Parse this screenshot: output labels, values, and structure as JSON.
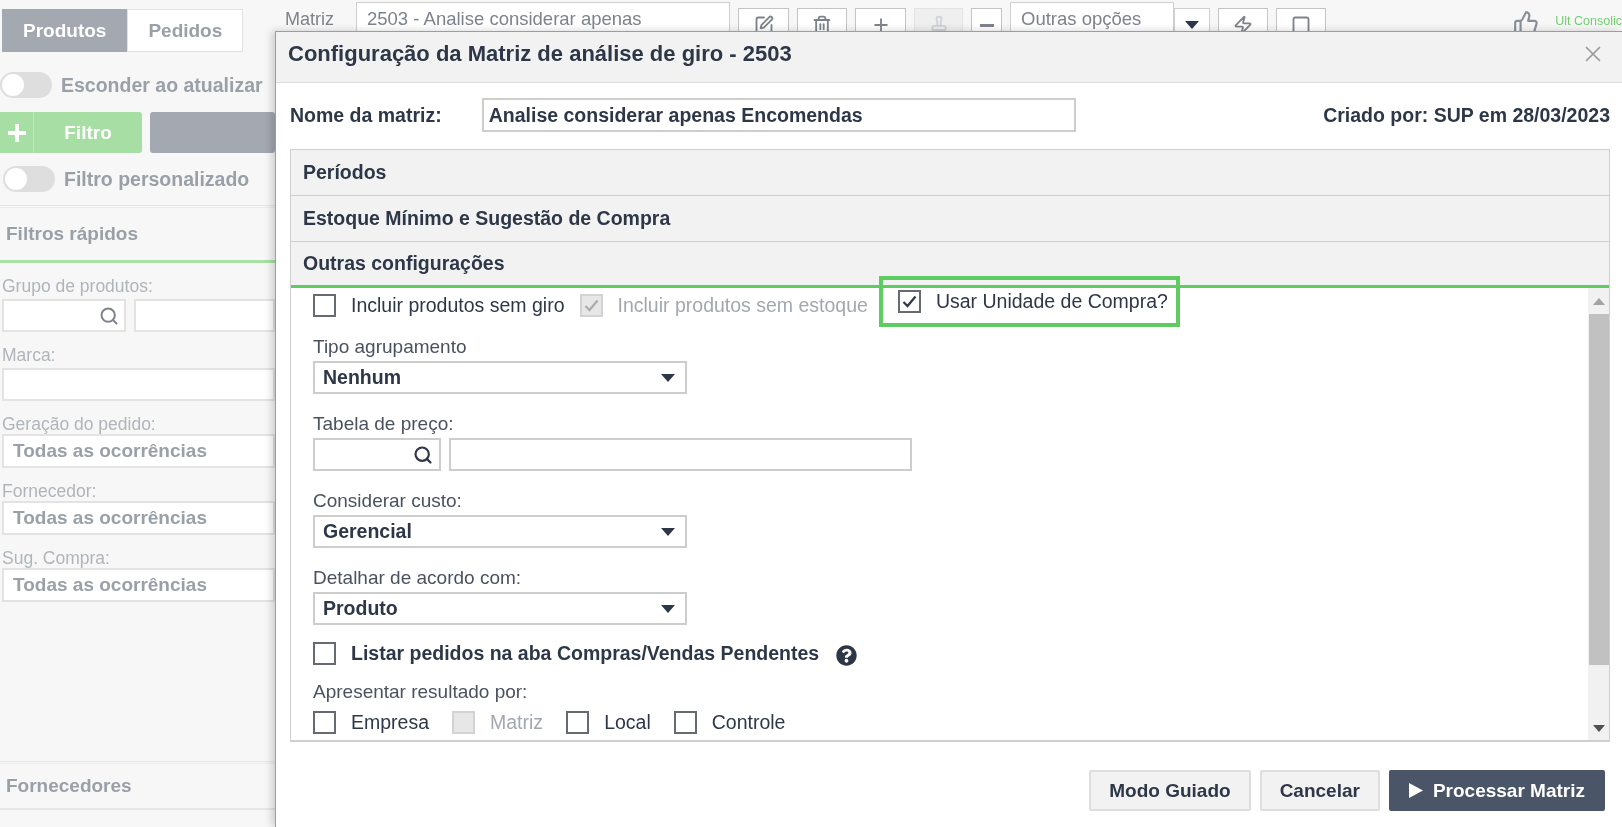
{
  "toolbar": {
    "label": "Matriz",
    "matrix": "2503 - Analise considerar apenas",
    "tools": [
      {
        "kind": "icon",
        "disabled": false
      },
      {
        "kind": "icon",
        "disabled": false
      },
      {
        "kind": "icon",
        "disabled": false
      },
      {
        "kind": "icon",
        "disabled": true
      },
      {
        "kind": "icon",
        "disabled": false
      },
      {
        "kind": "menu",
        "label": "Outras opções"
      },
      {
        "kind": "icon",
        "disabled": false
      },
      {
        "kind": "icon",
        "disabled": false
      }
    ],
    "status": "Ult Consolic"
  },
  "sidebar": {
    "tabs": [
      {
        "label": "Produtos",
        "selected": true
      },
      {
        "label": "Pedidos",
        "selected": false
      }
    ],
    "hide_toggle": {
      "label": "Esconder ao atualizar",
      "on": false
    },
    "filter_button": "Filtro",
    "custom_filter_toggle": {
      "label": "Filtro personalizado",
      "on": false
    },
    "quick_filters": {
      "title": "Filtros rápidos",
      "fields": [
        {
          "kind": "lookup",
          "label": "Grupo de produtos:"
        },
        {
          "kind": "text",
          "label": "Marca:"
        },
        {
          "kind": "select",
          "label": "Geração do pedido:",
          "value": "Todas as ocorrências"
        },
        {
          "kind": "select",
          "label": "Fornecedor:",
          "value": "Todas as ocorrências"
        },
        {
          "kind": "select",
          "label": "Sug. Compra:",
          "value": "Todas as ocorrências"
        }
      ]
    },
    "sections": [
      {
        "title": "Fornecedores"
      }
    ]
  },
  "dialog": {
    "title": "Configuração da Matriz de análise de giro - 2503",
    "name_label": "Nome da matriz:",
    "name_value": "Analise considerar apenas Encomendas",
    "created_by": "Criado por: SUP em 28/03/2023",
    "sections": [
      {
        "title": "Períodos",
        "expanded": false
      },
      {
        "title": "Estoque Mínimo e Sugestão de Compra",
        "expanded": false
      },
      {
        "title": "Outras configurações",
        "expanded": true
      }
    ],
    "options": [
      {
        "label": "Incluir produtos sem giro",
        "checked": false,
        "disabled": false,
        "highlighted": false
      },
      {
        "label": "Incluir produtos sem estoque",
        "checked": true,
        "disabled": true,
        "highlighted": false
      },
      {
        "label": "Usar Unidade de Compra?",
        "checked": true,
        "disabled": false,
        "highlighted": true
      }
    ],
    "fields": [
      {
        "kind": "select",
        "label": "Tipo agrupamento",
        "value": "Nenhum"
      },
      {
        "kind": "lookup",
        "label": "Tabela de preço:"
      },
      {
        "kind": "select",
        "label": "Considerar custo:",
        "value": "Gerencial"
      },
      {
        "kind": "select",
        "label": "Detalhar de acordo com:",
        "value": "Produto"
      }
    ],
    "list_orders": {
      "label": "Listar pedidos na aba Compras/Vendas Pendentes",
      "checked": false
    },
    "result_by": {
      "label": "Apresentar resultado por:",
      "options": [
        {
          "label": "Empresa",
          "checked": false,
          "disabled": false
        },
        {
          "label": "Matriz",
          "checked": false,
          "disabled": true
        },
        {
          "label": "Local",
          "checked": false,
          "disabled": false
        },
        {
          "label": "Controle",
          "checked": false,
          "disabled": false
        }
      ]
    },
    "buttons": [
      {
        "kind": "secondary",
        "label": "Modo Guiado"
      },
      {
        "kind": "secondary",
        "label": "Cancelar"
      },
      {
        "kind": "primary",
        "label": "Processar Matriz"
      }
    ]
  }
}
